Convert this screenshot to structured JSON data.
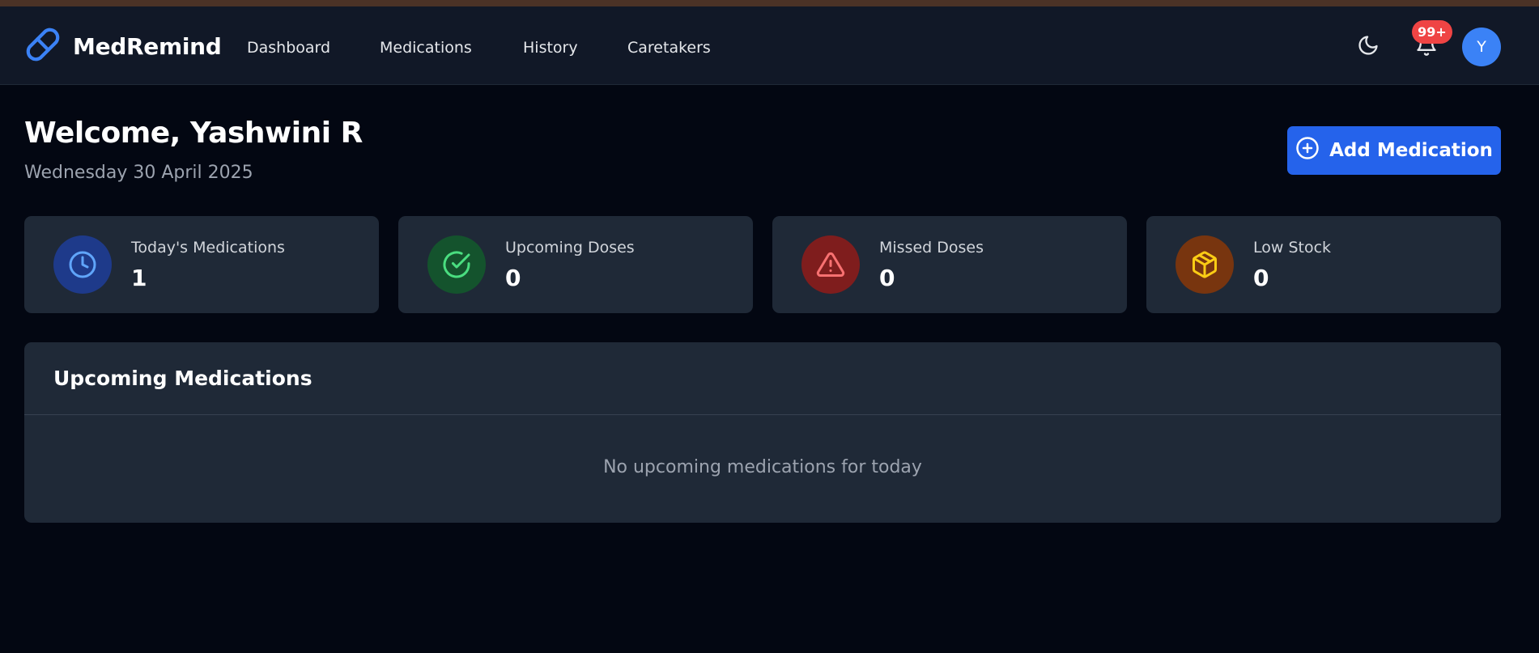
{
  "colors": {
    "background": "#030712",
    "navbar": "#111827",
    "card": "#1f2937",
    "accent": "#2563eb",
    "avatar": "#3b82f6",
    "badge": "#ef4444"
  },
  "header": {
    "brand": "MedRemind",
    "brand_icon": "pill-icon",
    "nav": [
      {
        "label": "Dashboard"
      },
      {
        "label": "Medications"
      },
      {
        "label": "History"
      },
      {
        "label": "Caretakers"
      }
    ],
    "theme_icon": "moon-icon",
    "notifications": {
      "icon": "bell-icon",
      "badge": "99+"
    },
    "avatar_initial": "Y"
  },
  "main": {
    "welcome": "Welcome, Yashwini R",
    "date": "Wednesday 30 April 2025",
    "add_button": {
      "label": "Add Medication",
      "icon": "plus-circle-icon"
    },
    "stats": [
      {
        "label": "Today's Medications",
        "value": "1",
        "icon": "clock-icon",
        "color": "#60a5fa",
        "bg": "#1e3a8a"
      },
      {
        "label": "Upcoming Doses",
        "value": "0",
        "icon": "check-circle-icon",
        "color": "#4ade80",
        "bg": "#14532d"
      },
      {
        "label": "Missed Doses",
        "value": "0",
        "icon": "alert-triangle-icon",
        "color": "#f87171",
        "bg": "#7f1d1d"
      },
      {
        "label": "Low Stock",
        "value": "0",
        "icon": "package-icon",
        "color": "#facc15",
        "bg": "#78350f"
      }
    ],
    "upcoming": {
      "title": "Upcoming Medications",
      "empty_text": "No upcoming medications for today"
    }
  }
}
